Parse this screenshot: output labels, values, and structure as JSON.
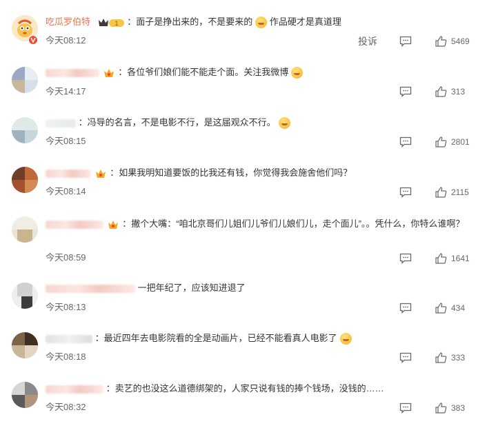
{
  "comments": [
    {
      "username": "吃瓜罗伯特",
      "level": "1",
      "text": "：面子是挣出来的，不是要来的",
      "text_after_emoji": " 作品硬才是真道理",
      "time": "今天08:12",
      "report_label": "投诉",
      "likes": "5469"
    },
    {
      "text": "：各位爷们娘们能不能走个面。关注我微博",
      "time": "今天14:17",
      "likes": "313"
    },
    {
      "text": "：冯导的名言，不是电影不行，是这届观众不行。",
      "time": "今天08:15",
      "likes": "2801"
    },
    {
      "text": "：如果我明知道要饭的比我还有钱，你觉得我会施舍他们吗？",
      "time": "今天08:14",
      "likes": "2115"
    },
    {
      "text": "：撇个大嘴：“咱北京哥们儿姐们儿爷们儿娘们儿，走个面儿”。。凭什么，你特么谁啊？",
      "time": "今天08:59",
      "likes": "1641"
    },
    {
      "text": "一把年纪了，应该知进退了",
      "time": "今天08:13",
      "likes": "434"
    },
    {
      "text": "：最近四年去电影院看的全是动画片，已经不能看真人电影了",
      "time": "今天08:18",
      "likes": "333"
    },
    {
      "text": "：卖艺的也没这么道德绑架的，人家只说有钱的捧个钱场，没钱的……",
      "time": "今天08:32",
      "likes": "383"
    }
  ]
}
